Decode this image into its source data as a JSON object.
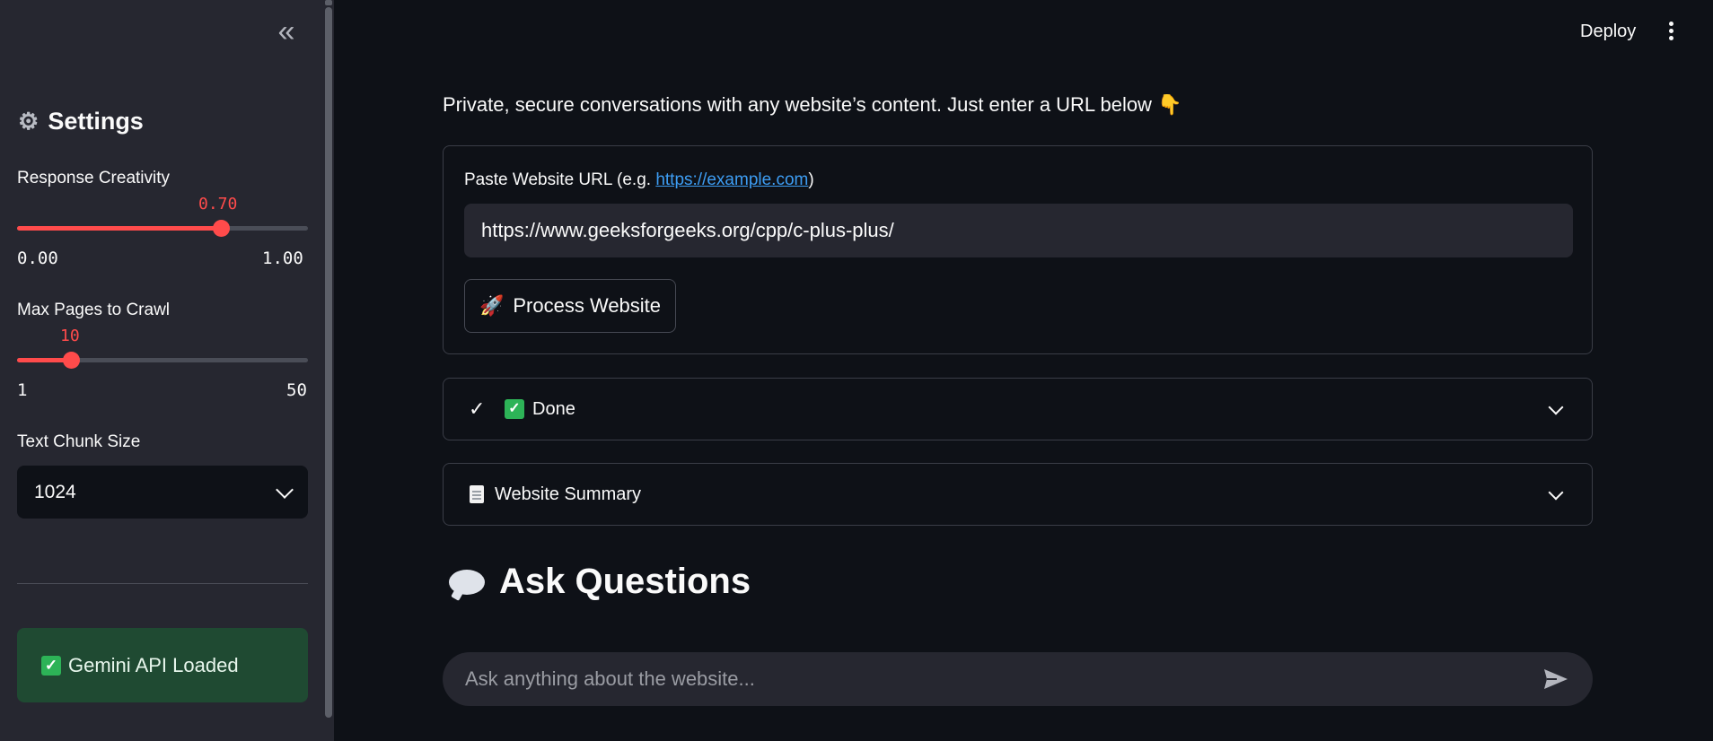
{
  "sidebar": {
    "collapse_icon": "double-chevron-left-icon",
    "settings_icon": "gear-icon",
    "settings_title": "Settings",
    "creativity": {
      "label": "Response Creativity",
      "value": "0.70",
      "min": "0.00",
      "max": "1.00",
      "fraction": 0.7
    },
    "max_pages": {
      "label": "Max Pages to Crawl",
      "value": "10",
      "min": "1",
      "max": "50",
      "fraction": 0.184
    },
    "chunk": {
      "label": "Text Chunk Size",
      "selected": "1024"
    },
    "status": "Gemini API Loaded"
  },
  "header": {
    "deploy_label": "Deploy",
    "menu_icon": "kebab-menu-icon"
  },
  "main": {
    "intro": "Private, secure conversations with any website’s content. Just enter a URL below 👇",
    "url_label_prefix": "Paste Website URL (e.g. ",
    "url_label_link": "https://example.com",
    "url_label_suffix": ")",
    "url_value": "https://www.geeksforgeeks.org/cpp/c-plus-plus/",
    "process_button": "Process Website",
    "process_icon": "rocket-icon",
    "done_label": "Done",
    "summary_label": "Website Summary",
    "ask_title": "Ask Questions",
    "chat_placeholder": "Ask anything about the website..."
  },
  "colors": {
    "accent": "#ff4b4b",
    "success_bg": "#1f4a32",
    "link": "#3d9df3",
    "background": "#0e1117",
    "sidebar": "#262730"
  }
}
